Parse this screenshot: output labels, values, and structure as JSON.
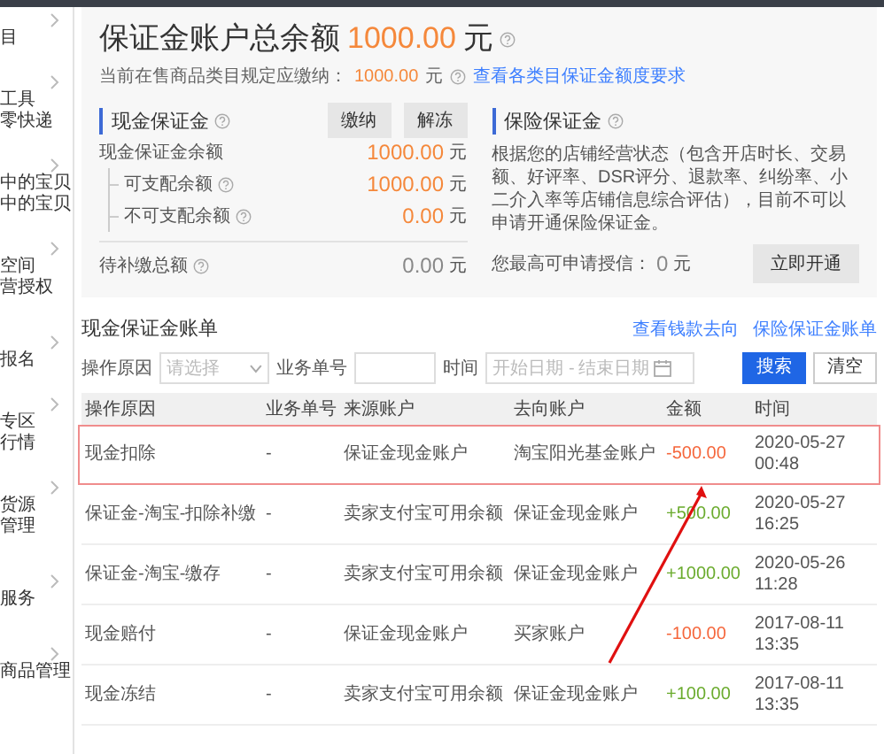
{
  "sidebar": {
    "groups": [
      {
        "labels": [
          "目"
        ]
      },
      {
        "labels": [
          "工具",
          "零快递"
        ]
      },
      {
        "labels": [
          "中的宝贝",
          "中的宝贝"
        ]
      },
      {
        "labels": [
          "空间",
          "营授权"
        ]
      },
      {
        "labels": [
          "报名"
        ]
      },
      {
        "labels": [
          "专区",
          "行情"
        ]
      },
      {
        "labels": [
          "货源",
          "管理"
        ]
      },
      {
        "labels": [
          "服务"
        ]
      },
      {
        "labels": [
          "商品管理"
        ]
      }
    ]
  },
  "balance": {
    "title": "保证金账户总余额",
    "amount": "1000.00",
    "unit": "元",
    "required_label": "当前在售商品类目规定应缴纳：",
    "required_amount": "1000.00",
    "required_unit": "元",
    "requirements_link": "查看各类目保证金额度要求"
  },
  "cash_deposit": {
    "title": "现金保证金",
    "buttons": [
      "缴纳",
      "解冻"
    ],
    "rows": [
      {
        "kind": "total",
        "label": "现金保证金余额",
        "help": false,
        "amount": "1000.00",
        "unit": "元"
      },
      {
        "kind": "sub",
        "label": "可支配余额",
        "help": true,
        "amount": "1000.00",
        "unit": "元"
      },
      {
        "kind": "sub",
        "label": "不可支配余额",
        "help": true,
        "amount": "0.00",
        "unit": "元"
      },
      {
        "kind": "pending",
        "label": "待补缴总额",
        "help": true,
        "amount": "0.00",
        "unit": "元"
      }
    ]
  },
  "insurance_deposit": {
    "title": "保险保证金",
    "description": "根据您的店铺经营状态（包含开店时长、交易额、好评率、DSR评分、退款率、纠纷率、小二介入率等店铺信息综合评估），目前不可以申请开通保险保证金。",
    "credit_label": "您最高可申请授信：",
    "credit_amount": "0",
    "credit_unit": "元",
    "button": "立即开通"
  },
  "ledger": {
    "title": "现金保证金账单",
    "links": [
      "查看钱款去向",
      "保险保证金账单"
    ],
    "filters": {
      "reason_label": "操作原因",
      "reason_placeholder": "请选择",
      "order_label": "业务单号",
      "time_label": "时间",
      "start_placeholder": "开始日期",
      "range_separator": "-",
      "end_placeholder": "结束日期"
    },
    "buttons": [
      {
        "label": "搜索",
        "kind": "primary"
      },
      {
        "label": "清空",
        "kind": "default"
      }
    ],
    "columns": [
      "操作原因",
      "业务单号",
      "来源账户",
      "去向账户",
      "金额",
      "时间"
    ],
    "rows": [
      {
        "highlighted": true,
        "kind": "debit",
        "cells": [
          "现金扣除",
          "-",
          "保证金现金账户",
          "淘宝阳光基金账户",
          "-500.00",
          "2020-05-27 00:48"
        ]
      },
      {
        "highlighted": false,
        "kind": "credit",
        "cells": [
          "保证金-淘宝-扣除补缴",
          "-",
          "卖家支付宝可用余额",
          "保证金现金账户",
          "+500.00",
          "2020-05-27 16:25"
        ]
      },
      {
        "highlighted": false,
        "kind": "credit",
        "cells": [
          "保证金-淘宝-缴存",
          "-",
          "卖家支付宝可用余额",
          "保证金现金账户",
          "+1000.00",
          "2020-05-26 11:28"
        ]
      },
      {
        "highlighted": false,
        "kind": "debit",
        "cells": [
          "现金赔付",
          "-",
          "保证金现金账户",
          "买家账户",
          "-100.00",
          "2017-08-11 13:35"
        ]
      },
      {
        "highlighted": false,
        "kind": "credit",
        "cells": [
          "现金冻结",
          "-",
          "卖家支付宝可用余额",
          "保证金现金账户",
          "+100.00",
          "2017-08-11 13:35"
        ]
      }
    ]
  }
}
